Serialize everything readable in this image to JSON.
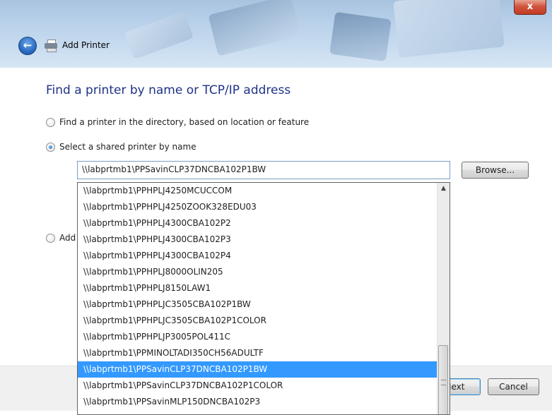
{
  "window": {
    "title": "Add Printer",
    "close_glyph": "x",
    "back_glyph": "←"
  },
  "heading": "Find a printer by name or TCP/IP address",
  "options": {
    "directory_label": "Find a printer in the directory, based on location or feature",
    "shared_label": "Select a shared printer by name",
    "add_label": "Add"
  },
  "printer_input": {
    "value": "\\\\labprtmb1\\PPSavinCLP37DNCBA102P1BW"
  },
  "buttons": {
    "browse": "Browse...",
    "next": "Next",
    "cancel": "Cancel"
  },
  "dropdown": {
    "items": [
      "\\\\labprtmb1\\PPHPLJ4250MCUCCOM",
      "\\\\labprtmb1\\PPHPLJ4250ZOOK328EDU03",
      "\\\\labprtmb1\\PPHPLJ4300CBA102P2",
      "\\\\labprtmb1\\PPHPLJ4300CBA102P3",
      "\\\\labprtmb1\\PPHPLJ4300CBA102P4",
      "\\\\labprtmb1\\PPHPLJ8000OLIN205",
      "\\\\labprtmb1\\PPHPLJ8150LAW1",
      "\\\\labprtmb1\\PPHPLJC3505CBA102P1BW",
      "\\\\labprtmb1\\PPHPLJC3505CBA102P1COLOR",
      "\\\\labprtmb1\\PPHPLJP3005POL411C",
      "\\\\labprtmb1\\PPMINOLTADI350CH56ADULTF",
      "\\\\labprtmb1\\PPSavinCLP37DNCBA102P1BW",
      "\\\\labprtmb1\\PPSavinCLP37DNCBA102P1COLOR",
      "\\\\labprtmb1\\PPSavinMLP150DNCBA102P3"
    ],
    "selected_index": 11
  },
  "colors": {
    "heading": "#1e3287",
    "selection": "#3399ff",
    "close_button": "#c23b22"
  }
}
